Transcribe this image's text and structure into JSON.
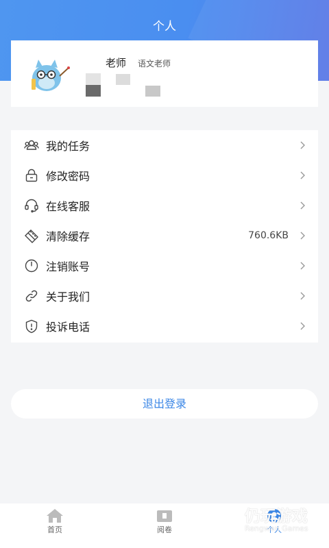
{
  "header": {
    "title": "个人"
  },
  "profile": {
    "name": "老师",
    "role": "语文老师"
  },
  "menu": [
    {
      "label": "我的任务",
      "icon": "users-icon",
      "value": ""
    },
    {
      "label": "修改密码",
      "icon": "lock-icon",
      "value": ""
    },
    {
      "label": "在线客服",
      "icon": "headset-icon",
      "value": ""
    },
    {
      "label": "清除缓存",
      "icon": "clear-icon",
      "value": "760.6KB"
    },
    {
      "label": "注销账号",
      "icon": "power-icon",
      "value": ""
    },
    {
      "label": "关于我们",
      "icon": "link-icon",
      "value": ""
    },
    {
      "label": "投诉电话",
      "icon": "alert-shield-icon",
      "value": ""
    }
  ],
  "logout": {
    "label": "退出登录"
  },
  "tabs": [
    {
      "label": "首页",
      "icon": "home-icon"
    },
    {
      "label": "阅卷",
      "icon": "folder-icon"
    },
    {
      "label": "个人",
      "icon": "person-icon"
    }
  ],
  "colors": {
    "accent": "#3a86e6",
    "header": "#4f96f0"
  },
  "watermark": {
    "title": "仍玩游戏",
    "subtitle": "Rengwan Games"
  }
}
